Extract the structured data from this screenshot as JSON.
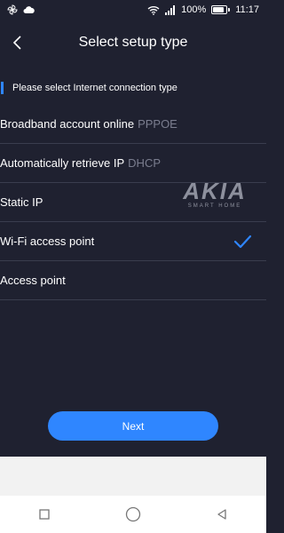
{
  "status_bar": {
    "time": "11:17",
    "battery_percent": "100%",
    "left_icons": [
      "pinwheel-icon",
      "cloud-icon"
    ],
    "right_icons": [
      "wifi-icon",
      "signal-icon"
    ]
  },
  "header": {
    "title": "Select setup type",
    "back_icon": "chevron-left-icon"
  },
  "section": {
    "label": "Please select Internet connection type"
  },
  "options": [
    {
      "label": "Broadband account online",
      "sub": "PPPOE",
      "selected": false
    },
    {
      "label": "Automatically retrieve IP",
      "sub": "DHCP",
      "selected": false
    },
    {
      "label": "Static IP",
      "sub": "",
      "selected": false
    },
    {
      "label": "Wi-Fi access point",
      "sub": "",
      "selected": true
    },
    {
      "label": "Access point",
      "sub": "",
      "selected": false
    }
  ],
  "watermark": {
    "brand": "AKIA",
    "tagline": "SMART HOME"
  },
  "next_button": {
    "label": "Next"
  },
  "colors": {
    "background": "#1f2130",
    "accent": "#2f86ff",
    "divider": "#3a3d4e",
    "subtext": "#7b7e8f"
  },
  "nav_bar": {
    "icons": [
      "square-icon",
      "circle-icon",
      "triangle-back-icon"
    ]
  }
}
